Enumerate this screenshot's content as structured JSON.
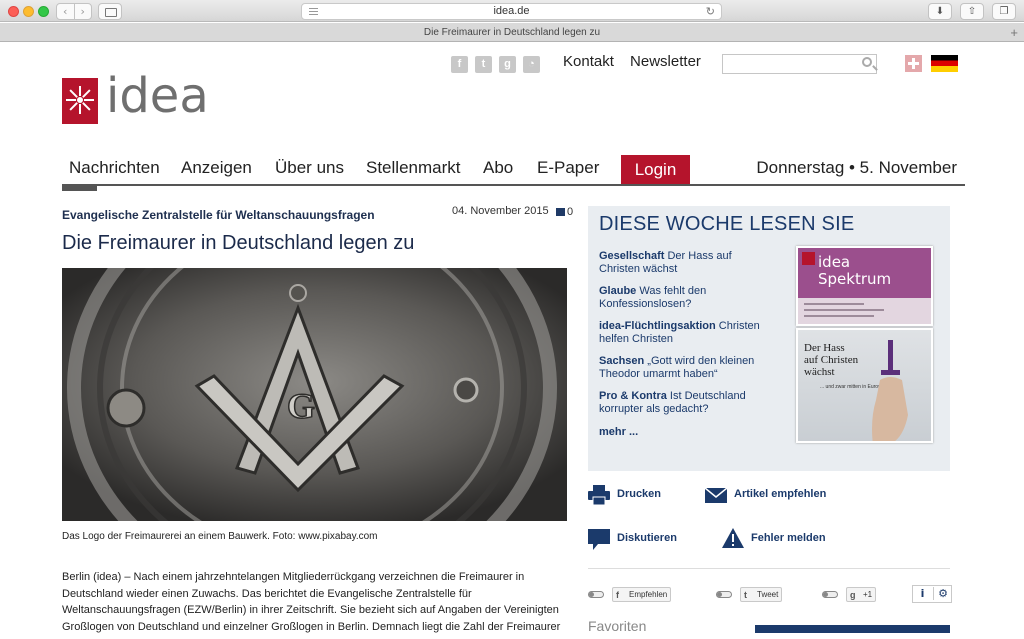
{
  "browser": {
    "url": "idea.de",
    "tab_title": "Die Freimaurer in Deutschland legen zu",
    "back_glyph": "‹",
    "forward_glyph": "›"
  },
  "header": {
    "social_icons": [
      "facebook-icon",
      "twitter-icon",
      "googleplus-icon",
      "rss-icon"
    ],
    "links": [
      "Kontakt",
      "Newsletter"
    ],
    "search": {
      "placeholder": "",
      "value": ""
    },
    "logo_text": "idea"
  },
  "nav": {
    "items": [
      "Nachrichten",
      "Anzeigen",
      "Über uns",
      "Stellenmarkt",
      "Abo",
      "E-Paper"
    ],
    "login": "Login",
    "date": "Donnerstag • 5. November"
  },
  "article": {
    "kicker": "Evangelische Zentralstelle für Weltanschauungsfragen",
    "date": "04. November 2015",
    "comments": "0",
    "headline": "Die Freimaurer in Deutschland legen zu",
    "caption": "Das Logo der Freimaurerei an einem Bauwerk. Foto: www.pixabay.com",
    "body": "Berlin (idea) – Nach einem jahrzehntelangen Mitgliederrückgang verzeichnen die Freimaurer in Deutschland wieder einen Zuwachs. Das berichtet die Evangelische Zentralstelle für Weltanschauungsfragen (EZW/Berlin) in ihrer Zeitschrift. Sie bezieht sich auf Angaben der Vereinigten Großlogen von Deutschland und einzelner Großlogen in Berlin. Demnach liegt die Zahl der Freimaurer"
  },
  "sidebar": {
    "title": "DIESE WOCHE LESEN SIE",
    "entries": [
      {
        "bold": "Gesellschaft",
        "text": " Der Hass auf Christen wächst"
      },
      {
        "bold": "Glaube",
        "text": " Was fehlt den Konfessionslosen?"
      },
      {
        "bold": "idea-Flüchtlingsaktion",
        "text": " Christen helfen Christen"
      },
      {
        "bold": "Sachsen",
        "text": " „Gott wird den kleinen Theodor umarmt haben“"
      },
      {
        "bold": "Pro & Kontra",
        "text": " Ist Deutschland korrupter als gedacht?"
      }
    ],
    "more": "mehr ...",
    "cover1_title": "idea\nSpektrum",
    "cover2_title": "Der Hass\nauf Christen\nwächst",
    "cover2_sub": "... und zwar mitten in Europa"
  },
  "actions": {
    "print": "Drucken",
    "recommend": "Artikel empfehlen",
    "discuss": "Diskutieren",
    "report": "Fehler melden"
  },
  "share": {
    "facebook": "Empfehlen",
    "twitter": "Tweet",
    "gplus": "+1",
    "info": "i",
    "settings": "⚙"
  },
  "favorites": "Favoriten",
  "colors": {
    "brand_red": "#b5142c",
    "navy": "#1b3a6b",
    "box_bg": "#e9edf1"
  }
}
